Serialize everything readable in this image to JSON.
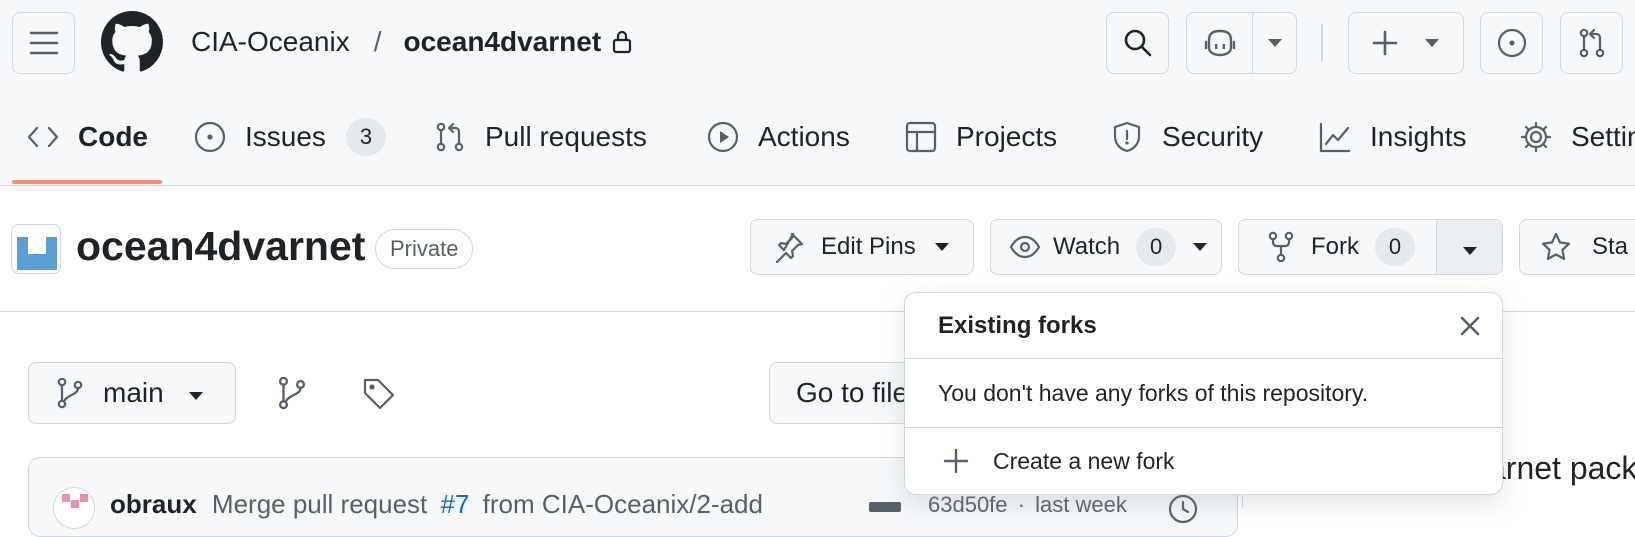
{
  "header": {
    "owner": "CIA-Oceanix",
    "separator": "/",
    "repo": "ocean4dvarnet"
  },
  "tabs": [
    {
      "id": "code",
      "label": "Code",
      "icon": "code-icon"
    },
    {
      "id": "issues",
      "label": "Issues",
      "icon": "issue-icon",
      "count": "3"
    },
    {
      "id": "pulls",
      "label": "Pull requests",
      "icon": "pull-request-icon"
    },
    {
      "id": "actions",
      "label": "Actions",
      "icon": "play-icon"
    },
    {
      "id": "projects",
      "label": "Projects",
      "icon": "table-icon"
    },
    {
      "id": "security",
      "label": "Security",
      "icon": "shield-icon"
    },
    {
      "id": "insights",
      "label": "Insights",
      "icon": "graph-icon"
    },
    {
      "id": "settings",
      "label": "Settin",
      "icon": "gear-icon"
    }
  ],
  "repo_header": {
    "name": "ocean4dvarnet",
    "visibility": "Private",
    "edit_pins": "Edit Pins",
    "watch": "Watch",
    "watch_count": "0",
    "fork": "Fork",
    "fork_count": "0",
    "star": "Sta"
  },
  "branch_bar": {
    "branch": "main",
    "go_to_file": "Go to file"
  },
  "forks_popover": {
    "title": "Existing forks",
    "message": "You don't have any forks of this repository.",
    "create": "Create a new fork"
  },
  "commit": {
    "author": "obraux",
    "message_prefix": "Merge pull request",
    "pr": "#7",
    "message_suffix": "from CIA-Oceanix/2-add",
    "sha": "63d50fe",
    "time": "last week"
  },
  "about": {
    "text": "arnet pack"
  },
  "colors": {
    "accent_underline": "#fd8c73",
    "link": "#0969da",
    "border": "#d0d7de",
    "header_bg": "#f6f8fa"
  }
}
